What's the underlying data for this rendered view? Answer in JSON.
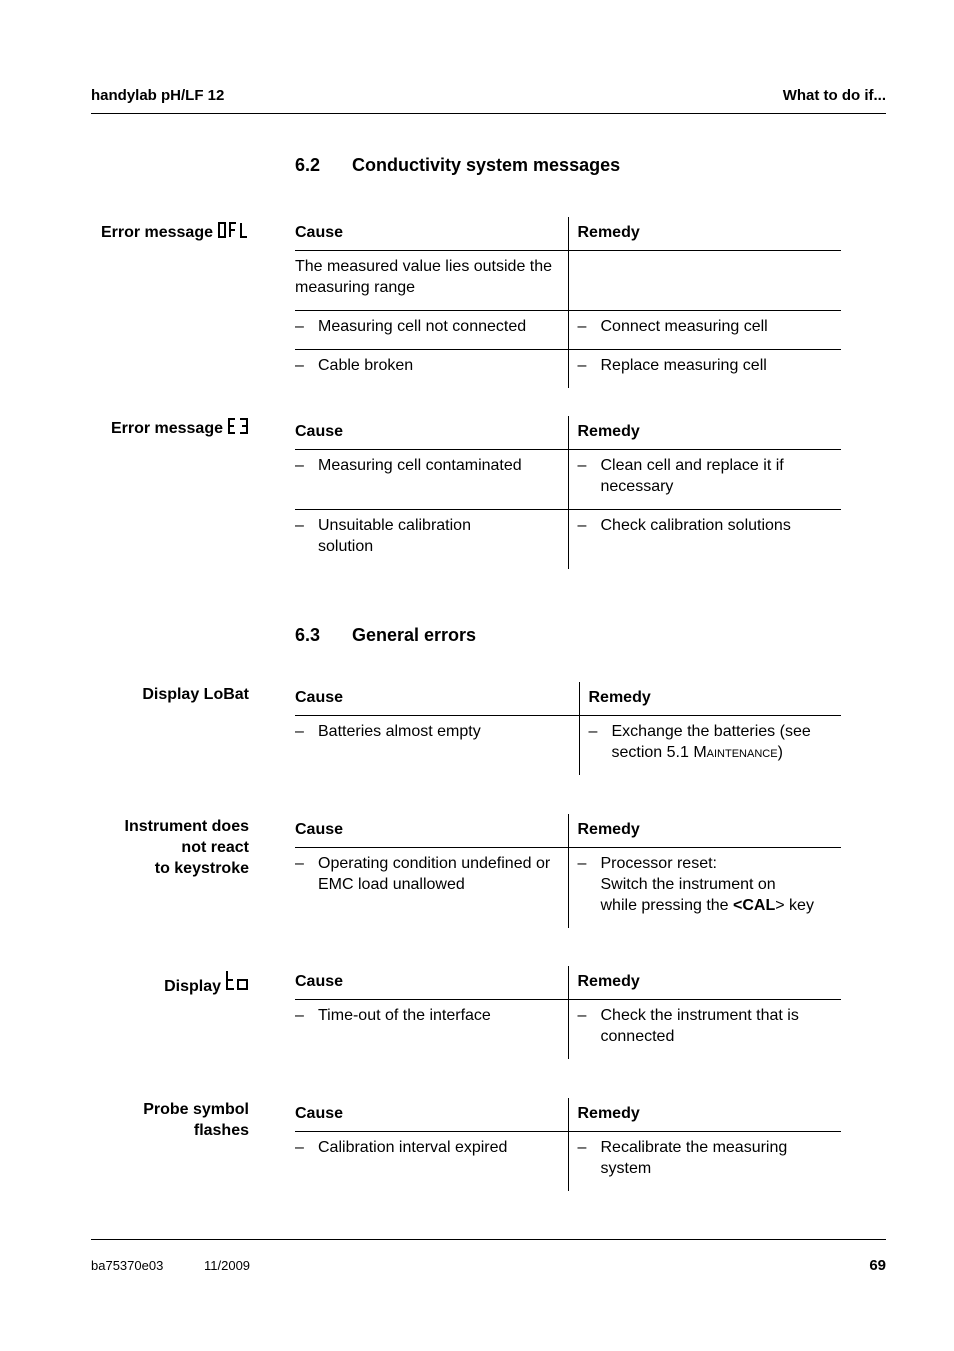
{
  "header": {
    "left": "handylab pH/LF 12",
    "right": "What to do if..."
  },
  "sections": [
    {
      "number": "6.2",
      "title": "Conductivity system messages"
    },
    {
      "number": "6.3",
      "title": "General errors"
    }
  ],
  "blocks": [
    {
      "label": "Error message",
      "lcd_icon": "OFL",
      "cause_header": "Cause",
      "remedy_header": "Remedy",
      "rows": [
        {
          "cause": "The measured value lies outside the measuring range",
          "cause_dash": false,
          "remedy": ""
        },
        {
          "cause": "Measuring cell not connected",
          "cause_dash": true,
          "remedy": "Connect measuring cell"
        },
        {
          "cause": "Cable broken",
          "cause_dash": true,
          "remedy": "Replace measuring cell"
        }
      ]
    },
    {
      "label": "Error message",
      "lcd_icon": "E3",
      "cause_header": "Cause",
      "remedy_header": "Remedy",
      "rows": [
        {
          "cause": "Measuring cell contaminated",
          "remedy": "Clean cell and replace it if necessary"
        },
        {
          "cause": "Unsuitable calibration solution",
          "remedy": "Check calibration solutions"
        }
      ]
    },
    {
      "label": "Display LoBat",
      "cause_header": "Cause",
      "remedy_header": "Remedy",
      "rows": [
        {
          "cause": "Batteries almost empty",
          "remedy_prefix": "Exchange the batteries (see section 5.1 ",
          "remedy_smallcaps": "Maintenance",
          "remedy_suffix": ")"
        }
      ]
    },
    {
      "label_lines": [
        "Instrument does",
        "not react",
        "to keystroke"
      ],
      "cause_header": "Cause",
      "remedy_header": "Remedy",
      "rows": [
        {
          "cause": "Operating condition undefined or EMC load unallowed",
          "remedy_line1": "Processor reset:",
          "remedy_line2": "Switch the instrument on",
          "remedy_line3_prefix": "while pressing the ",
          "remedy_key": "<CAL",
          "remedy_line3_suffix": "> key"
        }
      ]
    },
    {
      "label": "Display",
      "lcd_icon": "to",
      "cause_header": "Cause",
      "remedy_header": "Remedy",
      "rows": [
        {
          "cause": "Time-out of the interface",
          "remedy": "Check the instrument that is connected"
        }
      ]
    },
    {
      "label_lines": [
        "Probe symbol",
        "flashes"
      ],
      "cause_header": "Cause",
      "remedy_header": "Remedy",
      "rows": [
        {
          "cause": "Calibration interval expired",
          "remedy": "Recalibrate the measuring system"
        }
      ]
    }
  ],
  "dash": "–",
  "footer": {
    "doc_id": "ba75370e03",
    "date": "11/2009",
    "page": "69"
  }
}
